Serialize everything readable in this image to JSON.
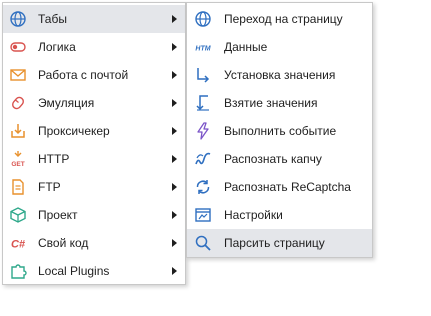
{
  "main_menu": {
    "items": [
      {
        "label": "Табы",
        "icon": "globe-icon",
        "has_submenu": true
      },
      {
        "label": "Логика",
        "icon": "toggle-icon",
        "has_submenu": true
      },
      {
        "label": "Работа с почтой",
        "icon": "envelope-icon",
        "has_submenu": true
      },
      {
        "label": "Эмуляция",
        "icon": "mouse-icon",
        "has_submenu": true
      },
      {
        "label": "Проксичекер",
        "icon": "proxy-checker-icon",
        "has_submenu": true
      },
      {
        "label": "HTTP",
        "icon": "http-get-icon",
        "icon_text": "GET",
        "has_submenu": true
      },
      {
        "label": "FTP",
        "icon": "ftp-file-icon",
        "has_submenu": true
      },
      {
        "label": "Проект",
        "icon": "cube-icon",
        "has_submenu": true
      },
      {
        "label": "Свой код",
        "icon": "csharp-icon",
        "icon_text": "C#",
        "has_submenu": true
      },
      {
        "label": "Local Plugins",
        "icon": "puzzle-icon",
        "has_submenu": true
      }
    ]
  },
  "sub_menu": {
    "items": [
      {
        "label": "Переход на страницу",
        "icon": "globe-icon"
      },
      {
        "label": "Данные",
        "icon": "html-icon",
        "icon_text": "HTM"
      },
      {
        "label": "Установка значения",
        "icon": "arrow-set-value-icon"
      },
      {
        "label": "Взятие значения",
        "icon": "arrow-get-value-icon"
      },
      {
        "label": "Выполнить событие",
        "icon": "lightning-icon"
      },
      {
        "label": "Распознать капчу",
        "icon": "captcha-icon"
      },
      {
        "label": "Распознать ReCaptcha",
        "icon": "recaptcha-icon"
      },
      {
        "label": "Настройки",
        "icon": "window-settings-icon"
      },
      {
        "label": "Парсить страницу",
        "icon": "magnifier-icon",
        "highlighted": true
      }
    ]
  },
  "colors": {
    "blue": "#2f6fc0",
    "red": "#d9534f",
    "orange": "#e8912d",
    "green": "#2fa88b",
    "purple": "#7b55c8",
    "highlight": "#e4e6ea"
  }
}
